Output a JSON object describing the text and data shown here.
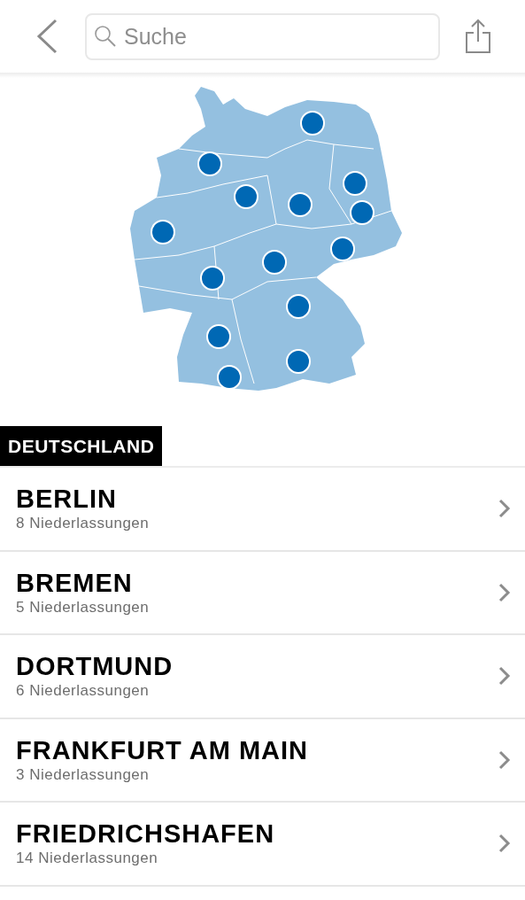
{
  "search": {
    "placeholder": "Suche"
  },
  "section": {
    "title": "DEUTSCHLAND"
  },
  "cities": [
    {
      "name": "BERLIN",
      "count": "8 Niederlassungen"
    },
    {
      "name": "BREMEN",
      "count": "5 Niederlassungen"
    },
    {
      "name": "DORTMUND",
      "count": "6 Niederlassungen"
    },
    {
      "name": "FRANKFURT AM MAIN",
      "count": "3 Niederlassungen"
    },
    {
      "name": "FRIEDRICHSHAFEN",
      "count": "14 Niederlassungen"
    }
  ]
}
